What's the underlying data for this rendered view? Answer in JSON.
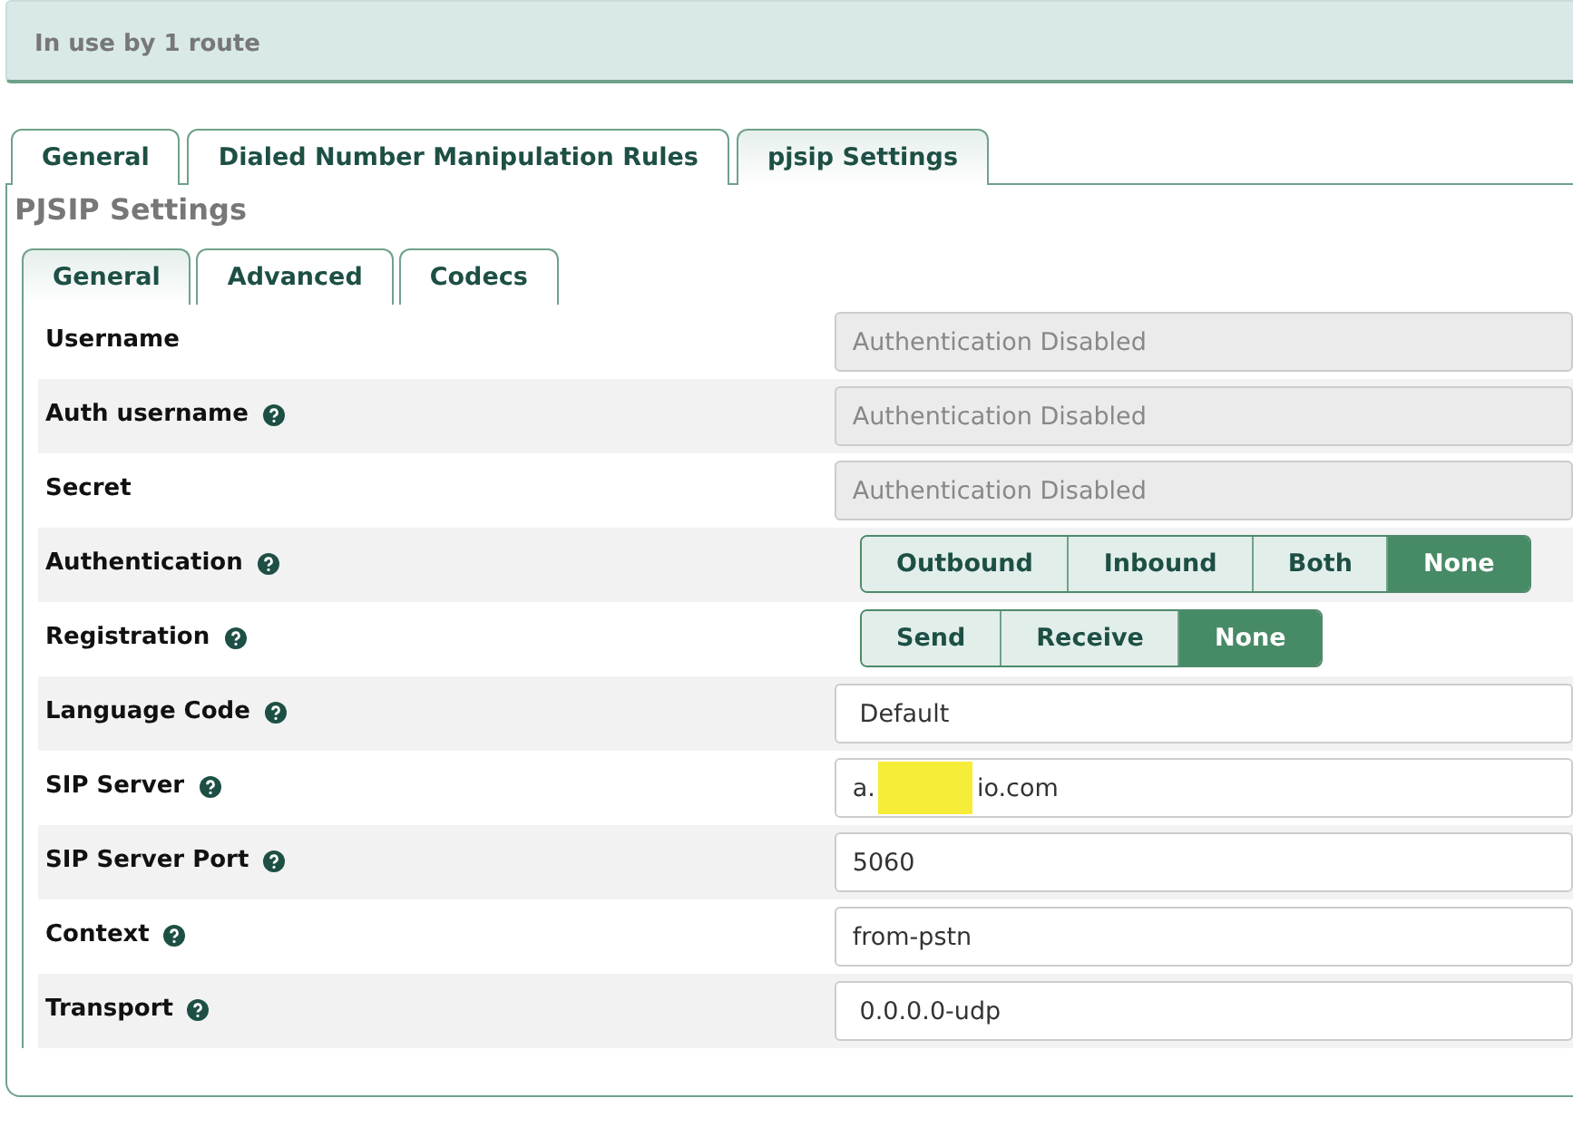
{
  "banner": {
    "text": "In use by 1 route"
  },
  "tabs": [
    {
      "label": "General",
      "selected": false
    },
    {
      "label": "Dialed Number Manipulation Rules",
      "selected": false
    },
    {
      "label": "pjsip Settings",
      "selected": true
    }
  ],
  "section_title": "PJSIP Settings",
  "subtabs": [
    {
      "label": "General",
      "selected": true
    },
    {
      "label": "Advanced",
      "selected": false
    },
    {
      "label": "Codecs",
      "selected": false
    }
  ],
  "fields": [
    {
      "label": "Username",
      "help": false,
      "kind": "text",
      "placeholder": "Authentication Disabled",
      "disabled": true
    },
    {
      "label": "Auth username",
      "help": true,
      "kind": "text",
      "placeholder": "Authentication Disabled",
      "disabled": true
    },
    {
      "label": "Secret",
      "help": false,
      "kind": "text",
      "placeholder": "Authentication Disabled",
      "disabled": true
    },
    {
      "label": "Authentication",
      "help": true,
      "kind": "toggle",
      "options": [
        {
          "label": "Outbound",
          "selected": false
        },
        {
          "label": "Inbound",
          "selected": false
        },
        {
          "label": "Both",
          "selected": false
        },
        {
          "label": "None",
          "selected": true
        }
      ]
    },
    {
      "label": "Registration",
      "help": true,
      "kind": "toggle",
      "options": [
        {
          "label": "Send",
          "selected": false
        },
        {
          "label": "Receive",
          "selected": false
        },
        {
          "label": "None",
          "selected": true
        }
      ]
    },
    {
      "label": "Language Code",
      "help": true,
      "kind": "select",
      "value": "Default"
    },
    {
      "label": "SIP Server",
      "help": true,
      "kind": "redacted",
      "value_before": "a.",
      "value_after": "io.com"
    },
    {
      "label": "SIP Server Port",
      "help": true,
      "kind": "text",
      "value": "5060",
      "disabled": false
    },
    {
      "label": "Context",
      "help": true,
      "kind": "text",
      "value": "from-pstn",
      "disabled": false
    },
    {
      "label": "Transport",
      "help": true,
      "kind": "select",
      "value": "0.0.0.0-udp"
    }
  ]
}
